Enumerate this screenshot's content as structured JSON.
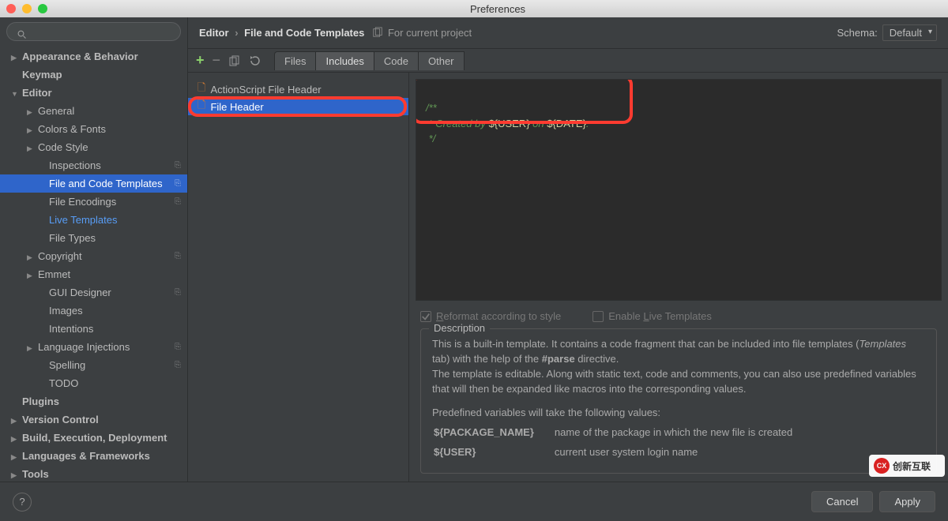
{
  "window": {
    "title": "Preferences"
  },
  "search": {
    "placeholder": ""
  },
  "sidebar": {
    "items": [
      {
        "label": "Appearance & Behavior",
        "depth": 1,
        "arrow": "closed"
      },
      {
        "label": "Keymap",
        "depth": 1,
        "arrow": "none"
      },
      {
        "label": "Editor",
        "depth": 1,
        "arrow": "open"
      },
      {
        "label": "General",
        "depth": 2,
        "arrow": "closed"
      },
      {
        "label": "Colors & Fonts",
        "depth": 2,
        "arrow": "closed"
      },
      {
        "label": "Code Style",
        "depth": 2,
        "arrow": "closed"
      },
      {
        "label": "Inspections",
        "depth": 3,
        "arrow": "none",
        "badge": true
      },
      {
        "label": "File and Code Templates",
        "depth": 3,
        "arrow": "none",
        "badge": true,
        "selected": true
      },
      {
        "label": "File Encodings",
        "depth": 3,
        "arrow": "none",
        "badge": true
      },
      {
        "label": "Live Templates",
        "depth": 3,
        "arrow": "none",
        "highlight": true
      },
      {
        "label": "File Types",
        "depth": 3,
        "arrow": "none"
      },
      {
        "label": "Copyright",
        "depth": 2,
        "arrow": "closed",
        "badge": true
      },
      {
        "label": "Emmet",
        "depth": 2,
        "arrow": "closed"
      },
      {
        "label": "GUI Designer",
        "depth": 3,
        "arrow": "none",
        "badge": true
      },
      {
        "label": "Images",
        "depth": 3,
        "arrow": "none"
      },
      {
        "label": "Intentions",
        "depth": 3,
        "arrow": "none"
      },
      {
        "label": "Language Injections",
        "depth": 2,
        "arrow": "closed",
        "badge": true
      },
      {
        "label": "Spelling",
        "depth": 3,
        "arrow": "none",
        "badge": true
      },
      {
        "label": "TODO",
        "depth": 3,
        "arrow": "none"
      },
      {
        "label": "Plugins",
        "depth": 1,
        "arrow": "none"
      },
      {
        "label": "Version Control",
        "depth": 1,
        "arrow": "closed"
      },
      {
        "label": "Build, Execution, Deployment",
        "depth": 1,
        "arrow": "closed"
      },
      {
        "label": "Languages & Frameworks",
        "depth": 1,
        "arrow": "closed"
      },
      {
        "label": "Tools",
        "depth": 1,
        "arrow": "closed"
      }
    ]
  },
  "header": {
    "crumbs": [
      "Editor",
      "File and Code Templates"
    ],
    "for_project": "For current project",
    "schema_label": "Schema:",
    "schema_value": "Default"
  },
  "tabs": [
    "Files",
    "Includes",
    "Code",
    "Other"
  ],
  "active_tab": 1,
  "templates": [
    {
      "name": "ActionScript File Header",
      "selected": false
    },
    {
      "name": "File Header",
      "selected": true
    }
  ],
  "code": {
    "line1": "/**",
    "line2_prefix": " * Created by ",
    "line2_var1": "${USER}",
    "line2_mid": " on ",
    "line2_var2": "${DATE}",
    "line2_suffix": ".",
    "line3": " */"
  },
  "options": {
    "reformat_prefix": "R",
    "reformat_label": "eformat according to style",
    "live_prefix": "Enable ",
    "live_underlined": "L",
    "live_suffix": "ive Templates"
  },
  "description": {
    "legend": "Description",
    "p1a": "This is a built-in template. It contains a code fragment that can be included into file templates (",
    "p1i": "Templates",
    "p1b": " tab) with the help of the ",
    "p1bold": "#parse",
    "p1c": " directive.",
    "p2": "The template is editable. Along with static text, code and comments, you can also use predefined variables that will then be expanded like macros into the corresponding values.",
    "p3": "Predefined variables will take the following values:",
    "vars": [
      {
        "k": "${PACKAGE_NAME}",
        "v": "name of the package in which the new file is created"
      },
      {
        "k": "${USER}",
        "v": "current user system login name"
      }
    ]
  },
  "footer": {
    "cancel": "Cancel",
    "apply": "Apply"
  },
  "watermark": {
    "text": "创新互联"
  }
}
